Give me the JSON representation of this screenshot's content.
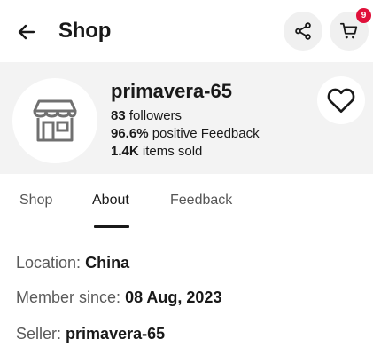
{
  "header": {
    "title": "Shop",
    "cart_count": "9"
  },
  "seller": {
    "name": "primavera-65",
    "followers_count": "83",
    "followers_label": "followers",
    "feedback_percent": "96.6%",
    "feedback_label": "positive Feedback",
    "items_sold_count": "1.4K",
    "items_sold_label": "items sold"
  },
  "tabs": [
    {
      "label": "Shop"
    },
    {
      "label": "About"
    },
    {
      "label": "Feedback"
    }
  ],
  "active_tab": "About",
  "about": {
    "location_label": "Location:",
    "location_value": "China",
    "member_since_label": "Member since:",
    "member_since_value": "08 Aug, 2023",
    "seller_label": "Seller:",
    "seller_value": "primavera-65"
  },
  "colors": {
    "badge": "#e0103a",
    "banner_bg": "#f3f3f3",
    "button_bg": "#f0f0f0",
    "text_primary": "#191919"
  },
  "icons": {
    "back": "arrow-left-icon",
    "share": "share-icon",
    "cart": "cart-icon",
    "store": "storefront-icon",
    "favorite": "heart-icon"
  }
}
